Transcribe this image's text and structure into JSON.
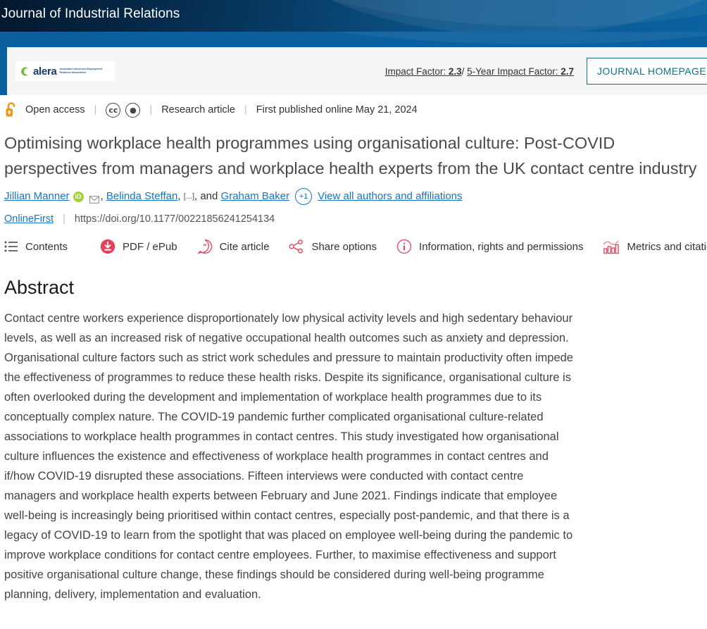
{
  "banner": {
    "journal_title": "Journal of Industrial Relations"
  },
  "journal_bar": {
    "logo": {
      "wordmark": "alera",
      "subtext": "Australian Labour and Employment Relations Association",
      "swirl_color": "#7ab648"
    },
    "impact_factor_label": "Impact Factor:",
    "impact_factor_value": "2.3",
    "impact_separator": "/",
    "five_year_label": "5-Year Impact Factor:",
    "five_year_value": "2.7",
    "homepage_button": "JOURNAL HOMEPAGE",
    "accent_color": "#107180"
  },
  "meta": {
    "access_label": "Open access",
    "lock_icon": "open-lock-icon",
    "lock_color": "#f0951a",
    "license_icons": [
      "cc-icon",
      "cc-by-icon"
    ],
    "article_type": "Research article",
    "published": "First published online May 21, 2024"
  },
  "article": {
    "title": "Optimising workplace health programmes using organisational culture: Post-COVID perspectives from managers and workplace health experts from the UK contact centre industry",
    "authors": [
      {
        "name": "Jillian Manner",
        "orcid": true,
        "email": true
      },
      {
        "name": "Belinda Steffan",
        "orcid": false,
        "email": false
      }
    ],
    "author_ellipsis": "[...]",
    "author_conjunction": ", and",
    "last_author": "Graham Baker",
    "additional_authors_badge": "+1",
    "view_all_authors": "View all authors and affiliations",
    "publication_stage": "OnlineFirst",
    "doi": "https://doi.org/10.1177/00221856241254134"
  },
  "toolbar": {
    "items": [
      {
        "label": "Contents",
        "icon": "list-icon"
      },
      {
        "label": "PDF / ePub",
        "icon": "download-circle-icon"
      },
      {
        "label": "Cite article",
        "icon": "quote-bubble-icon"
      },
      {
        "label": "Share options",
        "icon": "share-nodes-icon"
      },
      {
        "label": "Information, rights and permissions",
        "icon": "info-circle-icon"
      },
      {
        "label": "Metrics and citations",
        "icon": "bar-chart-icon"
      }
    ],
    "accent_color": "#e6405a"
  },
  "abstract": {
    "heading": "Abstract",
    "body": "Contact centre workers experience disproportionately low physical activity levels and high sedentary behaviour levels, as well as an increased risk of negative occupational health outcomes such as anxiety and depression. Organisational culture factors such as strict work schedules and pressure to maintain productivity often impede the effectiveness of programmes to reduce these health risks. Despite its significance, organisational culture is often overlooked during the development and implementation of workplace health programmes due to its conceptually complex nature. The COVID-19 pandemic further complicated organisational culture-related associations to workplace health programmes in contact centres. This study investigated how organisational culture influences the existence and effectiveness of workplace health programmes in contact centres and if/how COVID-19 disrupted these associations. Fifteen interviews were conducted with contact centre managers and workplace health experts between February and June 2021. Findings indicate that employee well-being is increasingly being prioritised within contact centres, especially post-pandemic, and that there is a legacy of COVID-19 to learn from the spotlight that was placed on employee well-being during the pandemic to improve workplace conditions for contact centre employees. Further, to maximise effectiveness and support positive organisational culture change, these findings should be considered during well-being programme planning, delivery, implementation and evaluation."
  }
}
